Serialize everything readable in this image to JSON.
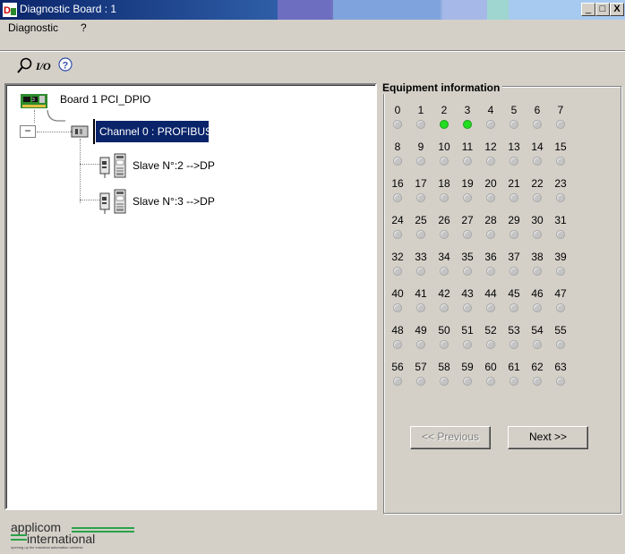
{
  "window": {
    "title": "Diagnostic Board : 1",
    "controls": {
      "minimize": "_",
      "maximize": "□",
      "close": "X"
    }
  },
  "menu": {
    "items": [
      "Diagnostic",
      "?"
    ]
  },
  "toolbar": {
    "buttons": [
      "search-icon",
      "io-icon",
      "help-icon"
    ],
    "io_label": "I/O"
  },
  "tree": {
    "board_label": "Board 1 PCI_DPIO",
    "channel_label": "Channel 0 : PROFIBUS",
    "expander": "−",
    "slaves": [
      "Slave N°:2 -->DP",
      "Slave N°:3 -->DP"
    ]
  },
  "equipment": {
    "title": "Equipment information",
    "slot_rows": [
      [
        "0",
        "1",
        "2",
        "3",
        "4",
        "5",
        "6",
        "7"
      ],
      [
        "8",
        "9",
        "10",
        "11",
        "12",
        "13",
        "14",
        "15"
      ],
      [
        "16",
        "17",
        "18",
        "19",
        "20",
        "21",
        "22",
        "23"
      ],
      [
        "24",
        "25",
        "26",
        "27",
        "28",
        "29",
        "30",
        "31"
      ],
      [
        "32",
        "33",
        "34",
        "35",
        "36",
        "37",
        "38",
        "39"
      ],
      [
        "40",
        "41",
        "42",
        "43",
        "44",
        "45",
        "46",
        "47"
      ],
      [
        "48",
        "49",
        "50",
        "51",
        "52",
        "53",
        "54",
        "55"
      ],
      [
        "56",
        "57",
        "58",
        "59",
        "60",
        "61",
        "62",
        "63"
      ]
    ],
    "active_slots": [
      2,
      3
    ],
    "previous_label": "<< Previous",
    "next_label": "Next >>",
    "previous_enabled": false,
    "colors": {
      "active": "#22dd22",
      "inactive": "#c4c4c4"
    }
  },
  "logo": {
    "line1": "applicom",
    "line2": "international",
    "tagline": "opening up the industrial automation universe"
  }
}
